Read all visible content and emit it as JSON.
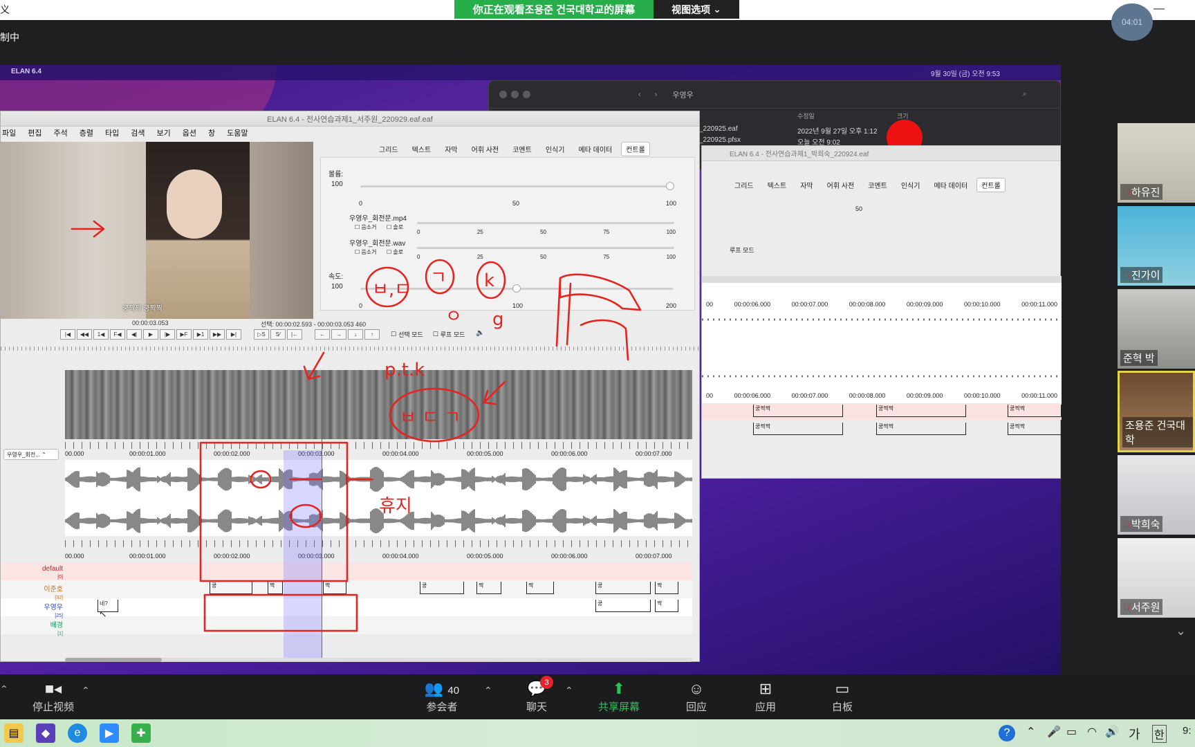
{
  "zoom_top": {
    "left_char": "义",
    "share_banner": "你正在观看조용준 건국대학교的屏幕",
    "view_options": "视图选项",
    "controlling_text": "制中",
    "time_badge": "04:01"
  },
  "mac": {
    "app_name": "ELAN 6.4",
    "menubar_right": "9월 30일 (금) 오전 9:53"
  },
  "finder": {
    "location": "우영우",
    "col_modified": "수정일",
    "col_size": "크기",
    "file1": "_220925.eaf",
    "file1_date": "2022년 9월 27일 오후 1:12",
    "file2": "_220925.pfsx",
    "file2_date": "오늘 오전 9:02"
  },
  "elan_left": {
    "title": "ELAN 6.4 - 전사연습과제1_서주원_220929.eaf.eaf",
    "menu": [
      "파일",
      "편집",
      "주석",
      "층렬",
      "타입",
      "검색",
      "보기",
      "옵션",
      "창",
      "도움말"
    ],
    "tabs": [
      "그리드",
      "텍스트",
      "자막",
      "어휘 사전",
      "코멘트",
      "인식기",
      "메타 데이터",
      "컨트롤"
    ],
    "selected_tab": "컨트롤",
    "video_subtitle": "쿵짝짝 쿵짝짝",
    "current_time": "00:00:03.053",
    "selection": "선택: 00:00:02.593 - 00:00:03.053  460",
    "volume_label": "볼륨:",
    "volume_value": "100",
    "volume_ticks": [
      "0",
      "50",
      "100"
    ],
    "media1": "우영우_회전문.mp4",
    "media2": "우영우_회전문.wav",
    "mute_label": "음소거",
    "solo_label": "솔로",
    "media_ticks": [
      "0",
      "25",
      "50",
      "75",
      "100"
    ],
    "speed_label": "속도:",
    "speed_value": "100",
    "speed_ticks": [
      "0",
      "100",
      "200"
    ],
    "select_mode": "선택 모드",
    "loop_mode": "루프 모드",
    "track_select": "우영우_회전...",
    "ruler": [
      "00.000",
      "00:00:01.000",
      "00:00:02.000",
      "00:00:03.000",
      "00:00:04.000",
      "00:00:05.000",
      "00:00:06.000",
      "00:00:07.000"
    ],
    "tiers": [
      {
        "name": "default",
        "count": "[0]"
      },
      {
        "name": "이준호",
        "count": "[32]"
      },
      {
        "name": "우영우",
        "count": "[25]"
      },
      {
        "name": "배경",
        "count": "[1]"
      }
    ],
    "annotations_junho": [
      "쿵",
      "짝",
      "짝",
      "쿵",
      "짝",
      "짝",
      "쿵",
      "짝"
    ],
    "annotations_woo": [
      "네?",
      "쿵",
      "짝"
    ]
  },
  "elan_right": {
    "title": "ELAN 6.4 - 전사연습과제1_박희숙_220924.eaf",
    "tabs": [
      "그리드",
      "텍스트",
      "자막",
      "어휘 사전",
      "코멘트",
      "인식기",
      "메타 데이터",
      "컨트롤"
    ],
    "selected_tab": "컨트롤",
    "tick_50": "50",
    "loop_mode": "루프 모드",
    "ruler": [
      "00",
      "00:00:06.000",
      "00:00:07.000",
      "00:00:08.000",
      "00:00:09.000",
      "00:00:10.000",
      "00:00:11.000"
    ],
    "annotations": [
      "쿵짝짝",
      "쿵짝짝",
      "쿵짝짝",
      "쿵짝짝",
      "쿵짝짝",
      "쿵짝짝"
    ]
  },
  "handwriting": [
    "ㅂ,ㄷ",
    "ㄱ",
    "k",
    "ㅇ",
    "g",
    "p.t.k",
    "ㅂ ㄷ ㄱ",
    "휴지"
  ],
  "participants": [
    {
      "name": "하유진",
      "muted": true
    },
    {
      "name": "진가이",
      "muted": true
    },
    {
      "name": "준혁 박",
      "muted": false
    },
    {
      "name": "조용준 건국대학",
      "muted": false,
      "active": true
    },
    {
      "name": "박희숙",
      "muted": true
    },
    {
      "name": "서주원",
      "muted": true
    }
  ],
  "toolbar": {
    "stop_video": "停止视频",
    "participants_count": "40",
    "participants": "参会者",
    "chat": "聊天",
    "chat_badge": "3",
    "share": "共享屏幕",
    "reactions": "回应",
    "apps": "应用",
    "whiteboard": "白板"
  },
  "taskbar": {
    "ime_ga": "가",
    "ime_han": "한",
    "clock": "9:"
  },
  "colors": {
    "banner_green": "#27ae4b",
    "share_green": "#29c55a",
    "annotation_red": "#e5231f",
    "active_tile_border": "#e5d44a"
  }
}
